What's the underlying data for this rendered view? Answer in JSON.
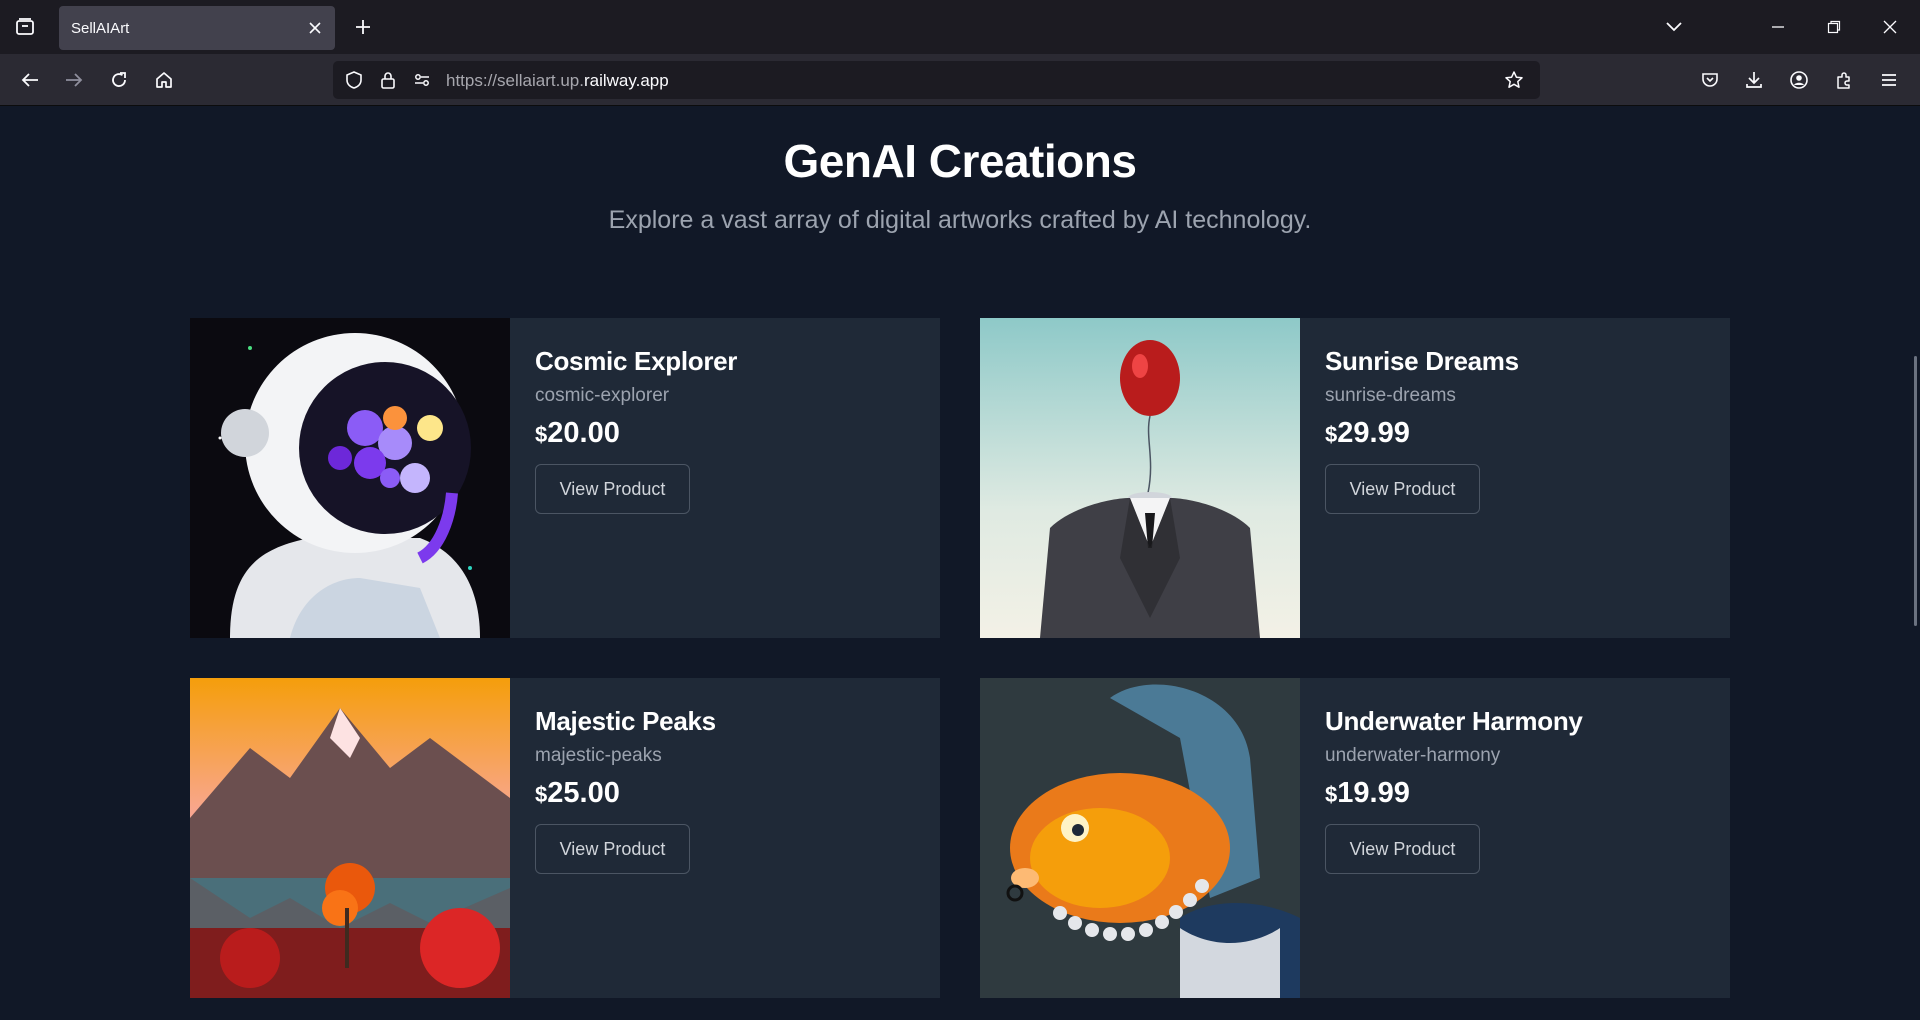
{
  "browser": {
    "tab_title": "SellAIArt",
    "url_prefix": "https://sellaiart.up.",
    "url_domain": "railway.app"
  },
  "page": {
    "title": "GenAI Creations",
    "subtitle": "Explore a vast array of digital artworks crafted by AI technology."
  },
  "products": [
    {
      "name": "Cosmic Explorer",
      "slug": "cosmic-explorer",
      "currency": "$",
      "price": "20.00",
      "button": "View Product",
      "image": "astronaut-with-flowers-art"
    },
    {
      "name": "Sunrise Dreams",
      "slug": "sunrise-dreams",
      "currency": "$",
      "price": "29.99",
      "button": "View Product",
      "image": "suit-with-red-balloon-art"
    },
    {
      "name": "Majestic Peaks",
      "slug": "majestic-peaks",
      "currency": "$",
      "price": "25.00",
      "button": "View Product",
      "image": "mountain-lake-sunset-art"
    },
    {
      "name": "Underwater Harmony",
      "slug": "underwater-harmony",
      "currency": "$",
      "price": "19.99",
      "button": "View Product",
      "image": "goldfish-portrait-art"
    }
  ],
  "colors": {
    "page_bg": "#111827",
    "card_bg": "#1f2937",
    "muted_text": "#9ca3af",
    "chrome_bg": "#1c1b22"
  }
}
